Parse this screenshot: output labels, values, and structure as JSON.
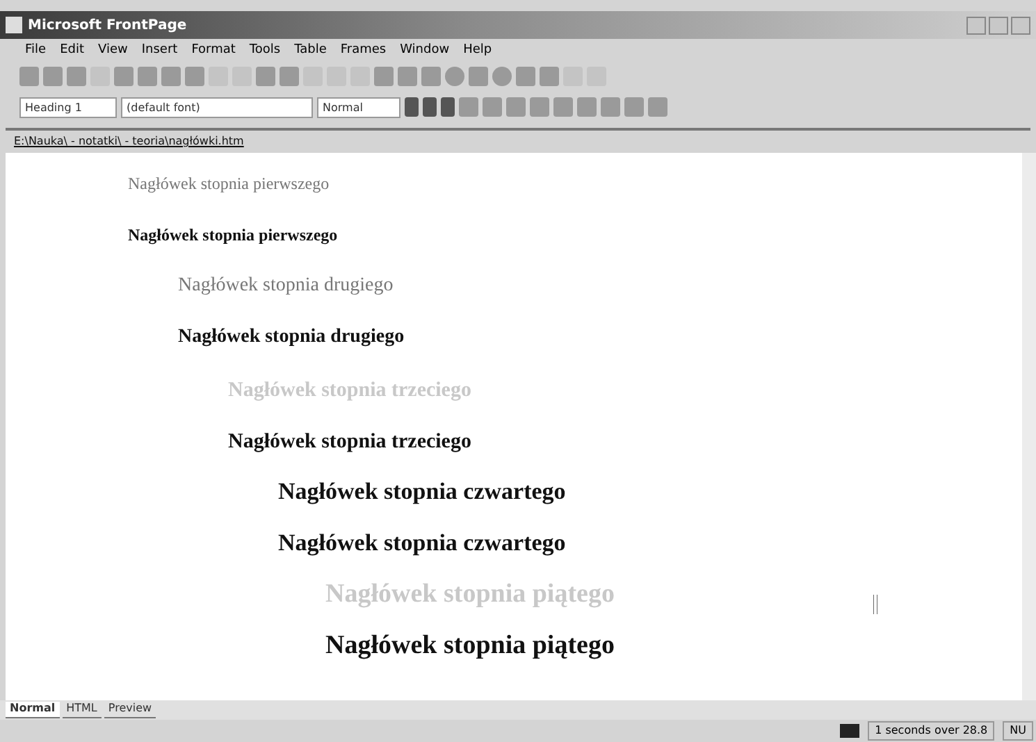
{
  "window": {
    "title": "Microsoft FrontPage"
  },
  "menu": [
    {
      "label": "File"
    },
    {
      "label": "Edit"
    },
    {
      "label": "View"
    },
    {
      "label": "Insert"
    },
    {
      "label": "Format"
    },
    {
      "label": "Tools"
    },
    {
      "label": "Table"
    },
    {
      "label": "Frames"
    },
    {
      "label": "Window"
    },
    {
      "label": "Help"
    }
  ],
  "format_bar": {
    "style": "Heading 1",
    "font": "(default font)",
    "size": "Normal"
  },
  "path_bar": {
    "path": "E:\\Nauka\\ - notatki\\ - teoria\\nagłówki.htm"
  },
  "heading_levels": [
    {
      "headings": [
        {
          "text": "Nagłówek stopnia pierwszego",
          "kind": "muted"
        },
        {
          "text": "Nagłówek stopnia pierwszego",
          "kind": "strong"
        }
      ]
    },
    {
      "headings": [
        {
          "text": "Nagłówek stopnia drugiego",
          "kind": "muted"
        },
        {
          "text": "Nagłówek stopnia drugiego",
          "kind": "strong"
        }
      ]
    },
    {
      "headings": [
        {
          "text": "Nagłówek stopnia trzeciego",
          "kind": "pale"
        },
        {
          "text": "Nagłówek stopnia trzeciego",
          "kind": "strong"
        }
      ]
    },
    {
      "headings": [
        {
          "text": "Nagłówek stopnia czwartego",
          "kind": "strong"
        },
        {
          "text": "Nagłówek stopnia czwartego",
          "kind": "strong"
        }
      ]
    },
    {
      "headings": [
        {
          "text": "Nagłówek stopnia piątego",
          "kind": "pale"
        },
        {
          "text": "Nagłówek stopnia piątego",
          "kind": "strong"
        }
      ]
    }
  ],
  "view_tabs": [
    {
      "label": "Normal",
      "selected": true
    },
    {
      "label": "HTML",
      "selected": false
    },
    {
      "label": "Preview",
      "selected": false
    }
  ],
  "status_bar": {
    "timing": "1 seconds over 28.8",
    "mode": "NU"
  }
}
